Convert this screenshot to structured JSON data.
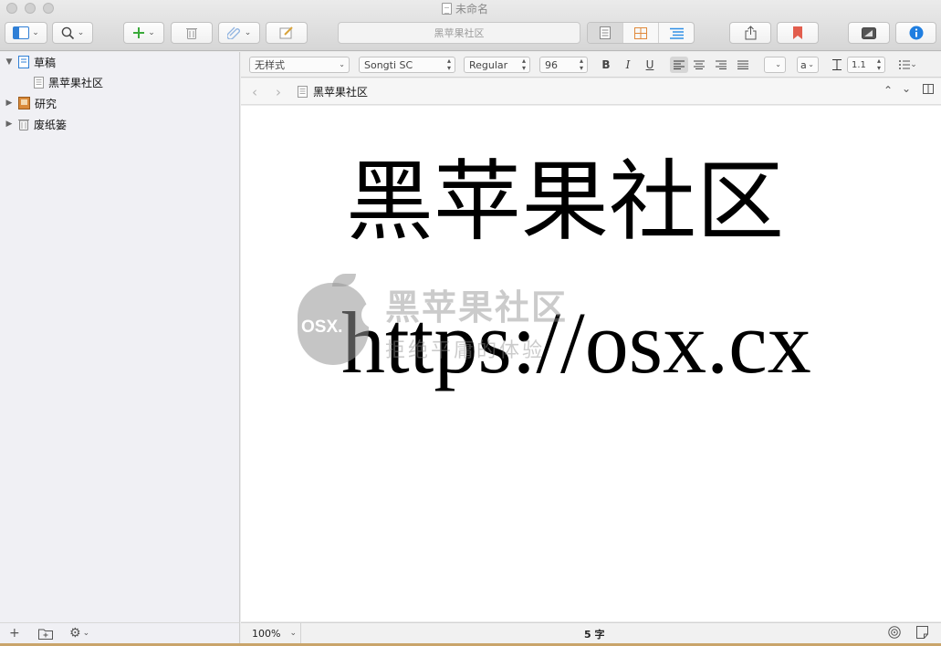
{
  "window": {
    "title": "未命名"
  },
  "toolbar": {
    "search_placeholder": "黑苹果社区"
  },
  "binder": {
    "items": [
      {
        "label": "草稿",
        "expanded": true,
        "icon": "draft-folder-icon"
      },
      {
        "label": "黑苹果社区",
        "icon": "document-icon"
      },
      {
        "label": "研究",
        "expanded": false,
        "icon": "research-folder-icon"
      },
      {
        "label": "废纸篓",
        "expanded": false,
        "icon": "trash-icon"
      }
    ]
  },
  "formatbar": {
    "style": "无样式",
    "font_family": "Songti SC",
    "font_weight": "Regular",
    "font_size": "96",
    "bold": "B",
    "italic": "I",
    "underline": "U",
    "text_color": "a",
    "line_spacing": "1.1"
  },
  "header": {
    "doc_title": "黑苹果社区"
  },
  "editor": {
    "line1": "黑苹果社区",
    "line2": "https://osx.cx"
  },
  "watermark": {
    "badge": "OSX.",
    "title": "黑苹果社区",
    "slogan": "拒绝平庸的体验"
  },
  "footer": {
    "zoom": "100%",
    "word_count": "5 字"
  },
  "colors": {
    "add_green": "#3aaa3a",
    "bookmark_red": "#e25d4d",
    "info_blue": "#1f7ee0",
    "grid_orange": "#e0883a",
    "outline_blue": "#2f8fe6"
  }
}
